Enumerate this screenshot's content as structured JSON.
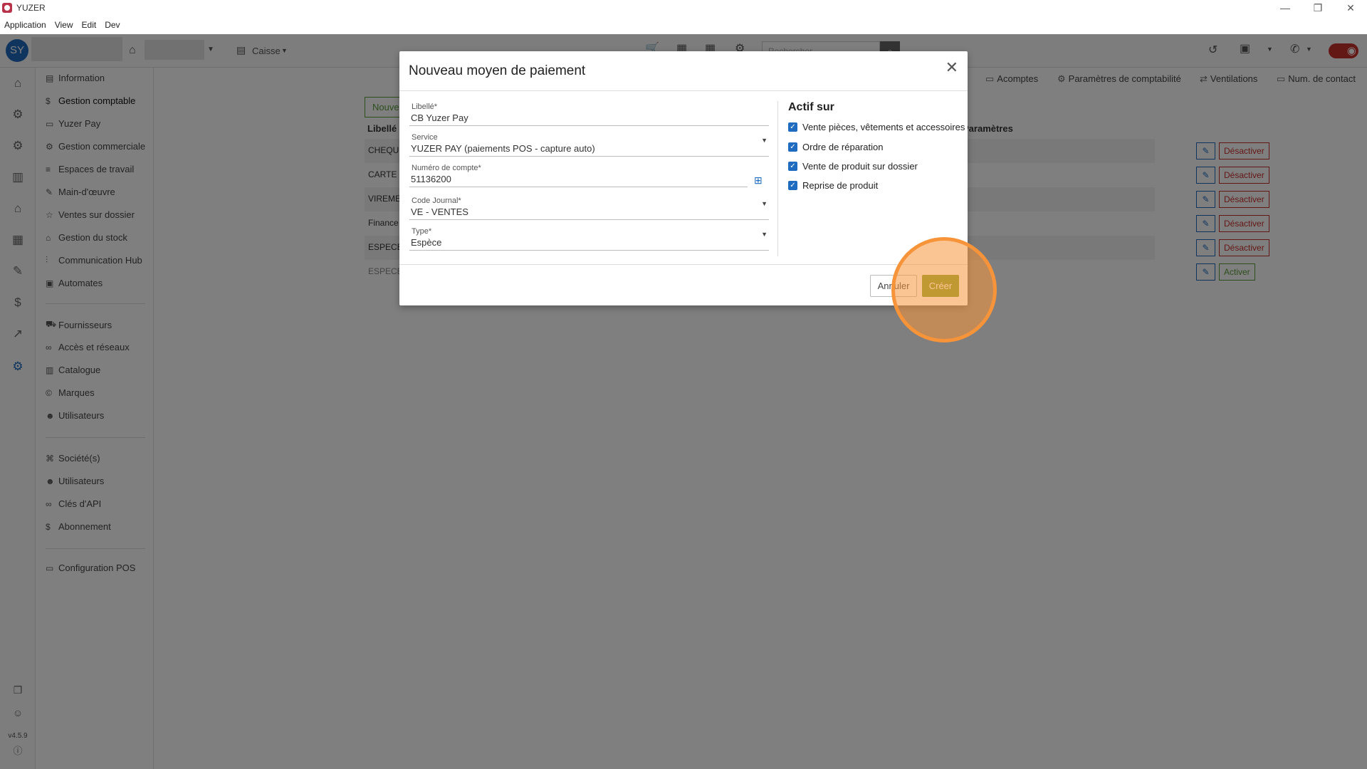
{
  "window": {
    "title": "YUZER",
    "controls": [
      "—",
      "❐",
      "✕"
    ]
  },
  "menu": [
    "Application",
    "View",
    "Edit",
    "Dev"
  ],
  "toolbar": {
    "avatar_initials": "SY",
    "caisse_label": "Caisse",
    "search_placeholder": "Rechercher"
  },
  "rail": {
    "version": "v4.5.9"
  },
  "subnav": {
    "group1": [
      "Information",
      "Gestion comptable",
      "Yuzer Pay",
      "Gestion commerciale",
      "Espaces de travail",
      "Main-d'œuvre",
      "Ventes sur dossier",
      "Gestion du stock",
      "Communication Hub",
      "Automates"
    ],
    "group2": [
      "Fournisseurs",
      "Accès et réseaux",
      "Catalogue",
      "Marques",
      "Utilisateurs"
    ],
    "group3": [
      "Société(s)",
      "Utilisateurs",
      "Clés d'API",
      "Abonnement"
    ],
    "group4": [
      "Configuration POS"
    ],
    "active": "Gestion comptable"
  },
  "content": {
    "tabs": [
      "Acomptes",
      "Paramètres de comptabilité",
      "Ventilations",
      "Num. de contact"
    ],
    "new_button": "Nouve",
    "headers": {
      "libelle": "Libellé",
      "parametres": "Paramètres"
    },
    "rows": [
      {
        "label": "CHEQU",
        "action": "Désactiver"
      },
      {
        "label": "CARTE B",
        "action": "Désactiver"
      },
      {
        "label": "VIREME",
        "action": "Désactiver"
      },
      {
        "label": "Finance",
        "action": "Désactiver"
      },
      {
        "label": "ESPECE",
        "action": "Désactiver"
      },
      {
        "label": "ESPECE",
        "action": "Activer"
      }
    ]
  },
  "modal": {
    "title": "Nouveau moyen de paiement",
    "fields": [
      {
        "label": "Libellé*",
        "value": "CB Yuzer Pay"
      },
      {
        "label": "Service",
        "value": "YUZER PAY (paiements POS - capture auto)"
      },
      {
        "label": "Numéro de compte*",
        "value": "51136200"
      },
      {
        "label": "Code Journal*",
        "value": "VE - VENTES"
      },
      {
        "label": "Type*",
        "value": "Espèce"
      }
    ],
    "actif_title": "Actif sur",
    "checkboxes": [
      {
        "label": "Vente pièces, vêtements et accessoires",
        "checked": true
      },
      {
        "label": "Ordre de réparation",
        "checked": true
      },
      {
        "label": "Vente de produit sur dossier",
        "checked": true
      },
      {
        "label": "Reprise de produit",
        "checked": true
      }
    ],
    "cancel_label": "Annuler",
    "create_label": "Créer"
  },
  "colors": {
    "accent": "#1e6bbf",
    "create": "#7fa12b",
    "danger": "#c9302c",
    "success": "#5a9c3a",
    "highlight": "#f7943a"
  }
}
